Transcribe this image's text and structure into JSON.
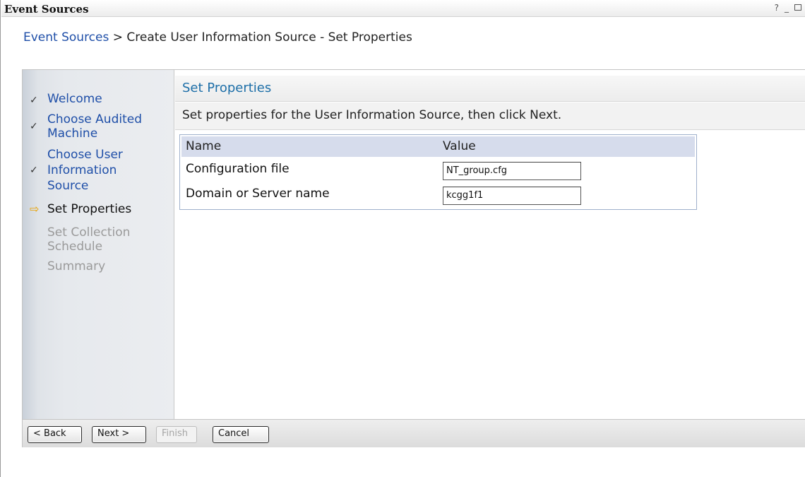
{
  "window": {
    "title": "Event Sources",
    "controls": {
      "help": "?",
      "minimize": "_"
    }
  },
  "breadcrumb": {
    "link": "Event Sources",
    "separator": ">",
    "current": "Create User Information Source - Set Properties"
  },
  "steps": [
    {
      "label": "Welcome",
      "status": "done",
      "mark": "✓"
    },
    {
      "label": "Choose Audited Machine",
      "line1": "Choose Audited",
      "line2": "Machine",
      "status": "done",
      "mark": "✓"
    },
    {
      "label": "Choose User Information Source",
      "line1": "Choose User",
      "line2": "Information",
      "line3": "Source",
      "status": "done",
      "mark": "✓"
    },
    {
      "label": "Set Properties",
      "status": "current",
      "mark": "⇨"
    },
    {
      "label": "Set Collection Schedule",
      "line1": "Set Collection",
      "line2": "Schedule",
      "status": "pending"
    },
    {
      "label": "Summary",
      "status": "pending"
    }
  ],
  "section": {
    "title": "Set Properties",
    "description": "Set properties for the User Information Source, then click Next."
  },
  "properties_table": {
    "headers": [
      "Name",
      "Value"
    ],
    "rows": [
      {
        "name": "Configuration file",
        "value": "NT_group.cfg"
      },
      {
        "name": "Domain or Server name",
        "value": "kcgg1f1"
      }
    ]
  },
  "buttons": {
    "back": "< Back",
    "next": "Next >",
    "finish": "Finish",
    "cancel": "Cancel"
  },
  "colors": {
    "link": "#1f4fa8",
    "section_title": "#1e6fa8",
    "current_arrow": "#e8a100",
    "table_header": "#d6dcec"
  }
}
